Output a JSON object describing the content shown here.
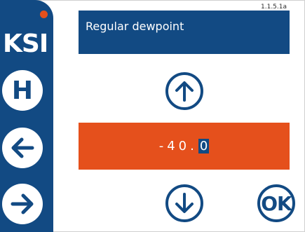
{
  "app": {
    "logo": "KSI",
    "version": "1.1.5.1a"
  },
  "nav": {
    "home_label": "H"
  },
  "screen": {
    "title": "Regular dewpoint",
    "value_editable": "-40.",
    "value_cursor_digit": "0",
    "ok_label": "OK"
  },
  "colors": {
    "primary": "#124a83",
    "accent": "#e5501c",
    "background": "#ffffff"
  },
  "icons": {
    "up": "arrow-up-icon",
    "down": "arrow-down-icon",
    "back": "arrow-left-icon",
    "forward": "arrow-right-icon"
  }
}
